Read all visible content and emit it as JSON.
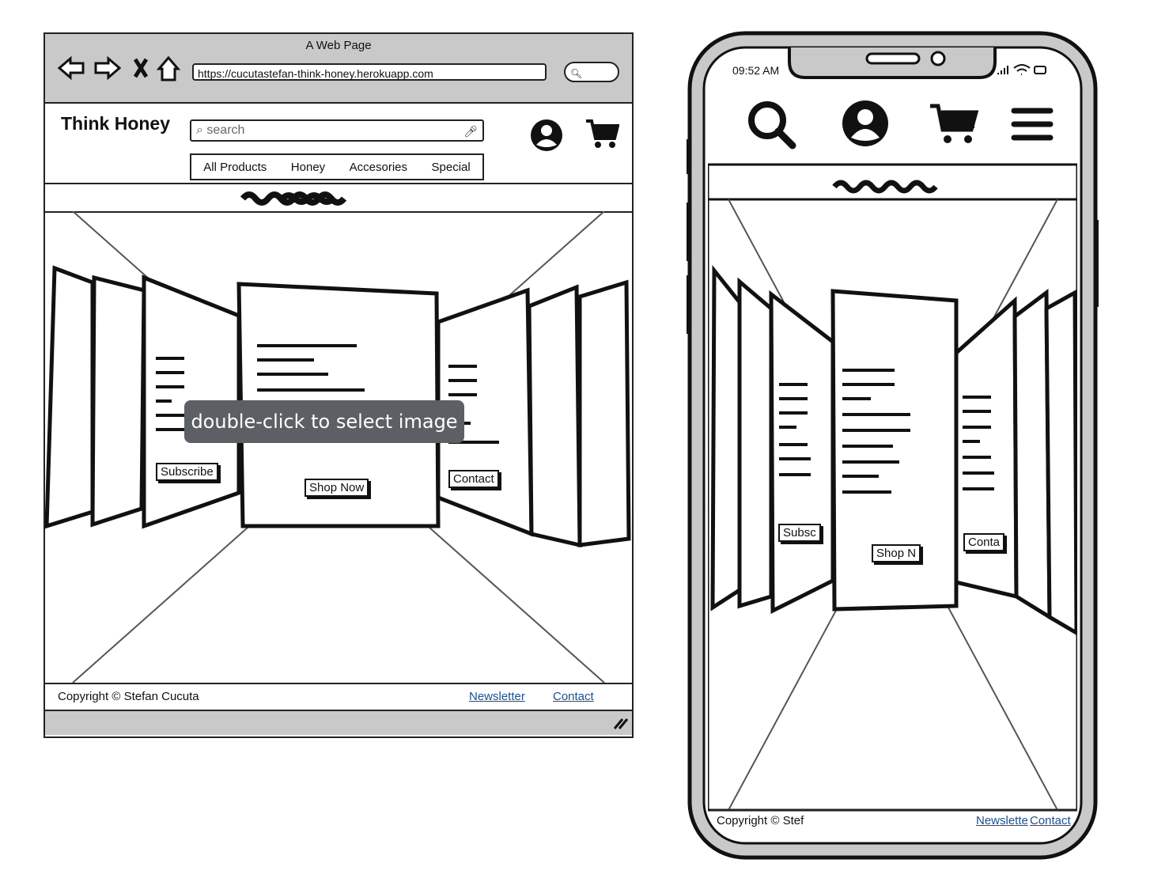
{
  "desktop": {
    "window_title": "A Web Page",
    "url": "https://cucutastefan-think-honey.herokuapp.com",
    "brand": "Think Honey",
    "search_placeholder": "search",
    "nav": [
      "All Products",
      "Honey",
      "Accesories",
      "Special"
    ],
    "buttons": {
      "subscribe": "Subscribe",
      "shop_now": "Shop Now",
      "contact": "Contact"
    },
    "tooltip": "double-click to select image",
    "footer": {
      "copyright": "Copyright © Stefan Cucuta",
      "newsletter": "Newsletter",
      "contact": "Contact"
    }
  },
  "mobile": {
    "time": "09:52 AM",
    "buttons": {
      "subscribe": "Subsc",
      "shop_now": "Shop N",
      "contact": "Conta"
    },
    "footer": {
      "copyright": "Copyright © Stef",
      "newsletter": "Newslette",
      "contact": "Contact"
    }
  },
  "colors": {
    "chrome": "#c9c9c9",
    "link": "#1d4f8f",
    "tooltip_bg": "#5c5f63"
  }
}
